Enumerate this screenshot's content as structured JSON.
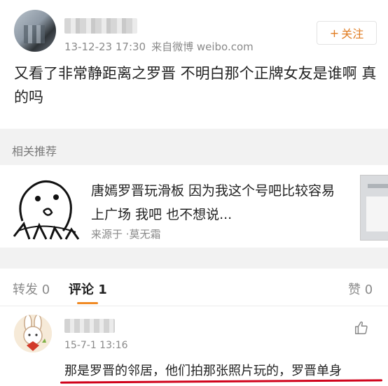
{
  "post": {
    "timestamp": "13-12-23 17:30",
    "source": "来自微博 weibo.com",
    "follow_label": "关注",
    "follow_icon": "plus-icon",
    "text": "又看了非常静距离之罗晋 不明白那个正牌女友是谁啊 真的吗"
  },
  "related": {
    "section_label": "相关推荐",
    "card_text": "唐嫣罗晋玩滑板 因为我这个号吧比较容易上广场 我吧 也不想说...",
    "card_source": "来源于 ·莫无霜"
  },
  "tabs": {
    "forward": "转发 0",
    "comment": "评论 1",
    "like": "赞 0"
  },
  "comment": {
    "time": "15-7-1 13:16",
    "text": "那是罗晋的邻居，他们拍那张照片玩的，罗晋单身",
    "like_icon": "thumbs-up-icon"
  },
  "colors": {
    "accent": "#f08a24",
    "follow": "#e07b20",
    "highlight_underline": "#d0021b"
  }
}
